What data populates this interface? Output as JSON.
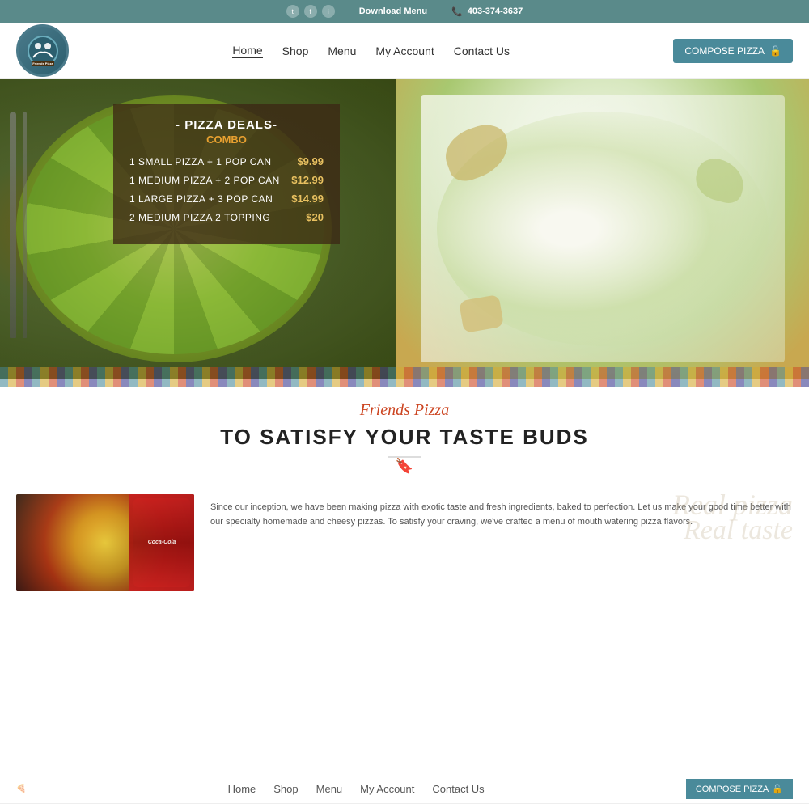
{
  "topbar": {
    "download": "Download Menu",
    "phone": "403-374-3637",
    "phone_icon": "📞"
  },
  "header": {
    "logo_name": "Friends Pizza",
    "nav": [
      "Home",
      "Shop",
      "Menu",
      "My Account",
      "Contact Us"
    ],
    "compose_btn": "COMPOSE PIZZA",
    "compose_icon": "🔒"
  },
  "hero": {
    "deals_title": "- PIZZA DEALS-",
    "deals_subtitle": "COMBO",
    "deals": [
      {
        "name": "1 SMALL PIZZA + 1 POP CAN",
        "price": "$9.99"
      },
      {
        "name": "1 MEDIUM PIZZA + 2 POP CAN",
        "price": "$12.99"
      },
      {
        "name": "1 LARGE PIZZA + 3 POP CAN",
        "price": "$14.99"
      },
      {
        "name": "2 MEDIUM PIZZA 2 TOPPING",
        "price": "$20"
      }
    ]
  },
  "tagline": {
    "script": "Friends Pizza",
    "main": "TO SATISFY YOUR TASTE BUDS",
    "bookmark": "🔖"
  },
  "description": {
    "watermark1": "Real pizza",
    "watermark2": "Real taste",
    "text": "Since our inception, we have been making pizza with exotic taste and fresh ingredients, baked to perfection. Let us make your good time better with our specialty homemade and cheesy pizzas. To satisfy your craving, we've crafted a menu of mouth watering pizza flavors."
  },
  "second_header": {
    "nav": [
      "Home",
      "Shop",
      "Menu",
      "My Account",
      "Contact Us"
    ],
    "compose_btn": "COMPOSE PIZZA"
  },
  "colors": {
    "teal": "#4a8a9a",
    "orange": "#e8a030",
    "red": "#cc4420"
  }
}
